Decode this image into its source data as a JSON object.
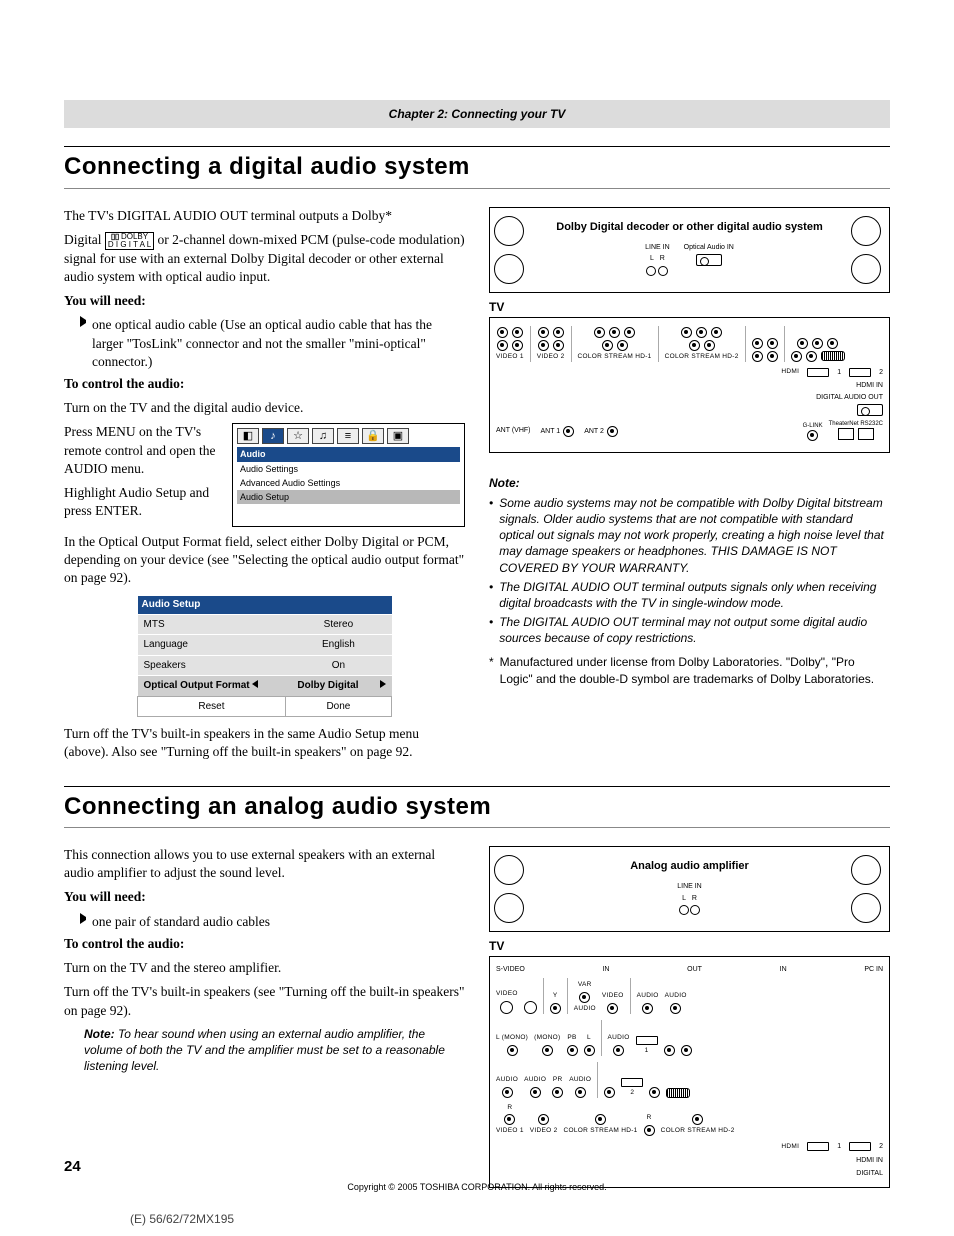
{
  "header_chapter": "Chapter 2: Connecting your TV",
  "section1_title": "Connecting a digital audio system",
  "s1_p1a": "The TV's DIGITAL AUDIO OUT terminal outputs a Dolby*",
  "s1_p1b": "Digital ",
  "dolby_label_top": "DOLBY",
  "dolby_label_bot": "D I G I T A L",
  "s1_p1c": " or 2-channel down-mixed PCM (pulse-code modulation) signal for use with an external Dolby Digital decoder or other external audio system with optical audio input.",
  "s1_need_head": "You will need:",
  "s1_need_item": "one optical audio cable (Use an optical audio cable that has the larger \"TosLink\" connector and not the smaller \"mini-optical\" connector.)",
  "s1_ctrl_head": "To control the audio:",
  "s1_ctrl_p1": "Turn on the TV and the digital audio device.",
  "s1_ctrl_p2": "Press MENU on the TV's remote control and open the AUDIO menu.",
  "s1_ctrl_p3": "Highlight Audio Setup and press ENTER.",
  "s1_p2": "In the Optical Output Format field, select either Dolby Digital or PCM, depending on your device (see \"Selecting the optical audio output format\" on page 92).",
  "osd": {
    "head": "Audio",
    "items": [
      "Audio Settings",
      "Advanced Audio Settings",
      "Audio Setup"
    ]
  },
  "audio_setup": {
    "title": "Audio Setup",
    "rows": [
      {
        "label": "MTS",
        "value": "Stereo"
      },
      {
        "label": "Language",
        "value": "English"
      },
      {
        "label": "Speakers",
        "value": "On"
      }
    ],
    "sel_label": "Optical Output Format",
    "sel_value": "Dolby Digital",
    "reset": "Reset",
    "done": "Done"
  },
  "s1_p3": "Turn off the TV's built-in speakers in the same Audio Setup menu (above). Also see \"Turning off the built-in speakers\" on page 92.",
  "diag1_box": "Dolby Digital decoder or other digital audio system",
  "line_in": "LINE IN",
  "l": "L",
  "r": "R",
  "opt_in": "Optical Audio IN",
  "tv_label": "TV",
  "ports": {
    "svideo": "S-VIDEO",
    "video": "VIDEO",
    "audio_lr_l": "L",
    "audio_lr_r": "R",
    "audio": "AUDIO",
    "mono": "(MONO)",
    "video1": "VIDEO 1",
    "video2": "VIDEO 2",
    "cshd1": "COLOR STREAM HD-1",
    "cshd2": "COLOR STREAM HD-2",
    "hdmi": "HDMI",
    "hdmi_in": "HDMI IN",
    "digital_audio_out": "DIGITAL AUDIO OUT",
    "ant_vhf": "ANT (VHF)",
    "ant1": "ANT 1",
    "ant2": "ANT 2",
    "glink": "G-LINK",
    "theaternet": "TheaterNet",
    "rs232c": "RS232C",
    "pc_in": "PC IN",
    "in": "IN",
    "out": "OUT",
    "y": "Y",
    "pb": "PB",
    "pr": "PR",
    "var": "VAR"
  },
  "note_head": "Note:",
  "notes": [
    "Some audio systems may not be compatible with Dolby Digital bitstream signals. Older audio systems that are not compatible with standard optical out signals may not work properly, creating a high noise level that may damage speakers or headphones. THIS DAMAGE IS NOT COVERED BY YOUR WARRANTY.",
    "The DIGITAL AUDIO OUT terminal outputs signals only when receiving digital broadcasts with the TV in single-window mode.",
    "The DIGITAL AUDIO OUT terminal may not output some digital audio sources because of copy restrictions."
  ],
  "footnote_mark": "*",
  "footnote": "Manufactured under license from Dolby Laboratories. \"Dolby\", \"Pro Logic\" and the double-D symbol are trademarks of Dolby Laboratories.",
  "section2_title": "Connecting an analog audio system",
  "s2_p1": "This connection allows you to use external speakers with an external audio amplifier to adjust the sound level.",
  "s2_need_head": "You will need:",
  "s2_need_item": "one pair of standard audio cables",
  "s2_ctrl_head": "To control the audio:",
  "s2_ctrl_p1": "Turn on the TV and the stereo amplifier.",
  "s2_ctrl_p2": "Turn off the TV's built-in speakers (see \"Turning off the built-in speakers\" on page 92).",
  "s2_note": "Note: To hear sound when using an external audio amplifier, the volume of both the TV and the amplifier must be set to a reasonable listening level.",
  "s2_note_head": "Note:",
  "s2_note_body": " To hear sound when using an external audio amplifier, the volume of both the TV and the amplifier must be set to a reasonable listening level.",
  "diag2_box": "Analog audio amplifier",
  "page_num": "24",
  "copyright": "Copyright © 2005 TOSHIBA CORPORATION. All rights reserved.",
  "doc_code": "(E) 56/62/72MX195"
}
